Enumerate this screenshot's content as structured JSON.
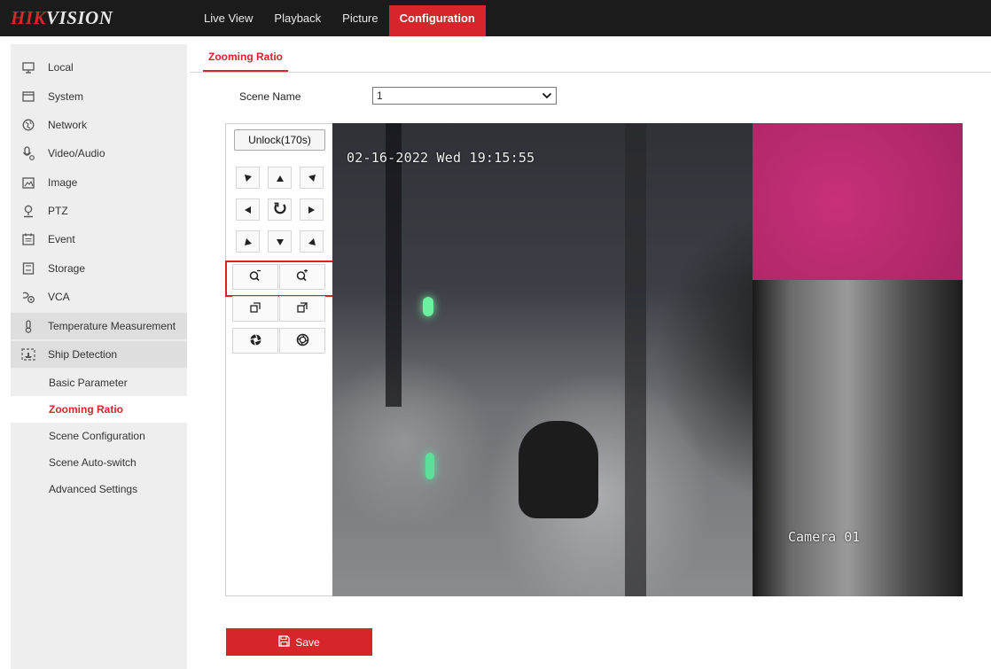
{
  "brand": {
    "part1": "HIK",
    "part2": "VISION"
  },
  "topnav": [
    {
      "label": "Live View",
      "active": false
    },
    {
      "label": "Playback",
      "active": false
    },
    {
      "label": "Picture",
      "active": false
    },
    {
      "label": "Configuration",
      "active": true
    }
  ],
  "sidebar": {
    "items": [
      {
        "label": "Local",
        "icon": "monitor-icon"
      },
      {
        "label": "System",
        "icon": "system-icon"
      },
      {
        "label": "Network",
        "icon": "network-icon"
      },
      {
        "label": "Video/Audio",
        "icon": "mic-icon"
      },
      {
        "label": "Image",
        "icon": "image-icon"
      },
      {
        "label": "PTZ",
        "icon": "ptz-icon"
      },
      {
        "label": "Event",
        "icon": "calendar-icon"
      },
      {
        "label": "Storage",
        "icon": "storage-icon"
      },
      {
        "label": "VCA",
        "icon": "vca-icon"
      },
      {
        "label": "Temperature Measurement",
        "icon": "thermometer-icon"
      },
      {
        "label": "Ship Detection",
        "icon": "ship-icon"
      }
    ],
    "subitems": [
      {
        "label": "Basic Parameter",
        "active": false
      },
      {
        "label": "Zooming Ratio",
        "active": true
      },
      {
        "label": "Scene Configuration",
        "active": false
      },
      {
        "label": "Scene Auto-switch",
        "active": false
      },
      {
        "label": "Advanced Settings",
        "active": false
      }
    ]
  },
  "content": {
    "tab_label": "Zooming Ratio",
    "scene_label": "Scene Name",
    "scene_value": "1"
  },
  "ptz": {
    "unlock_label": "Unlock(170s)"
  },
  "video": {
    "osd_time": "02-16-2022 Wed 19:15:55",
    "osd_name": "Camera 01"
  },
  "save_label": "Save",
  "colors": {
    "accent": "#d7252c",
    "topbar": "#1b1b1b",
    "sidebar": "#eeeeee"
  }
}
